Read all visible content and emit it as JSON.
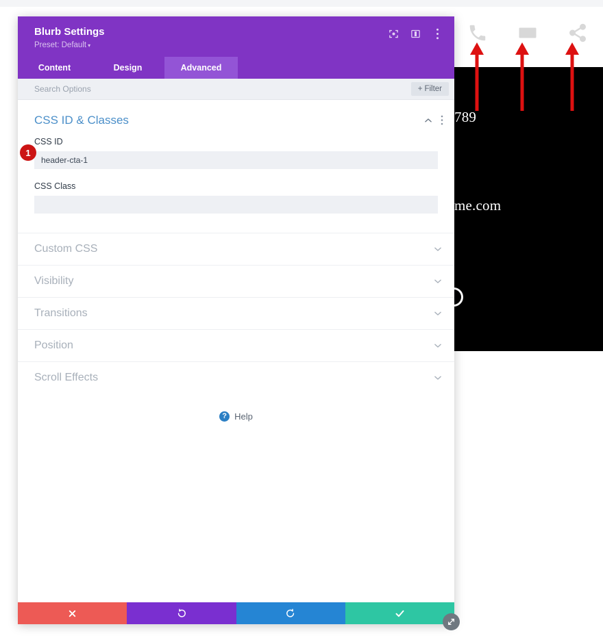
{
  "modal": {
    "title": "Blurb Settings",
    "preset": "Preset: Default",
    "preset_caret": "▾",
    "header_icons": [
      {
        "name": "focus-icon",
        "label": "Focus"
      },
      {
        "name": "layout-icon",
        "label": "Layout"
      },
      {
        "name": "more-options-icon",
        "label": "More Options"
      }
    ],
    "tabs": [
      {
        "label": "Content",
        "active": false
      },
      {
        "label": "Design",
        "active": false
      },
      {
        "label": "Advanced",
        "active": true
      }
    ],
    "search": {
      "placeholder": "Search Options",
      "value": ""
    },
    "filter_button": {
      "plus": "+",
      "label": "Filter"
    },
    "open_section": {
      "title": "CSS ID & Classes",
      "collapse_icon": "chevron-up",
      "menu_icon": "vertical-dots",
      "fields": [
        {
          "label": "CSS ID",
          "value": "header-cta-1",
          "placeholder": ""
        },
        {
          "label": "CSS Class",
          "value": "",
          "placeholder": ""
        }
      ]
    },
    "collapsed_sections": [
      {
        "label": "Custom CSS"
      },
      {
        "label": "Visibility"
      },
      {
        "label": "Transitions"
      },
      {
        "label": "Position"
      },
      {
        "label": "Scroll Effects"
      }
    ],
    "help": {
      "icon_glyph": "?",
      "label": "Help"
    },
    "footer_actions": [
      {
        "name": "discard-changes-button",
        "icon": "close-x",
        "color": "#ed5a55"
      },
      {
        "name": "undo-button",
        "icon": "undo-arrow",
        "color": "#7a2fd0"
      },
      {
        "name": "redo-button",
        "icon": "redo-arrow",
        "color": "#2585d4"
      },
      {
        "name": "save-changes-button",
        "icon": "checkmark",
        "color": "#2ec6a3"
      }
    ],
    "resize_handle": {
      "name": "resize-handle-icon"
    }
  },
  "annotation": {
    "badge_number": "1",
    "badge_color": "#cc1414",
    "arrow_color": "#dd1111",
    "arrow_count": 3
  },
  "background_preview": {
    "icons": [
      {
        "name": "phone-icon"
      },
      {
        "name": "envelope-icon"
      },
      {
        "name": "share-icon"
      }
    ],
    "phone_number_fragment": "789",
    "email_fragment": "me.com"
  },
  "colors": {
    "modal_header_purple": "#8034c4",
    "active_tab_purple": "#9354d6",
    "section_title_blue": "#4b8fc9",
    "input_background": "#eef0f4",
    "help_blue": "#2c7fc4"
  }
}
